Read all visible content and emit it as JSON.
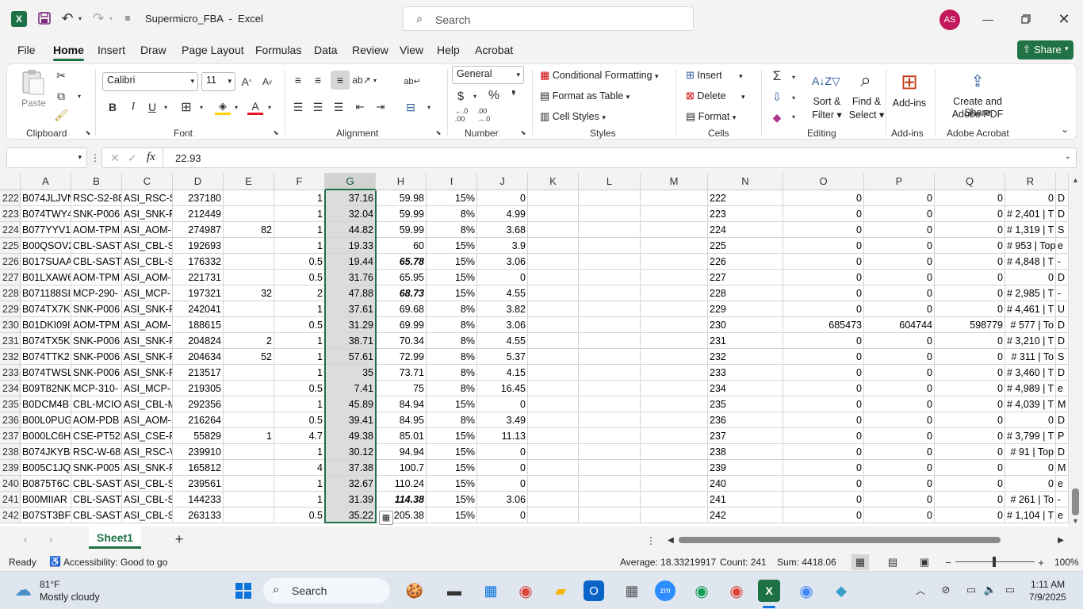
{
  "window": {
    "title": "Supermicro_FBA  -  Excel",
    "search_placeholder": "Search",
    "avatar": "AS"
  },
  "menu": {
    "tabs": [
      "File",
      "Home",
      "Insert",
      "Draw",
      "Page Layout",
      "Formulas",
      "Data",
      "Review",
      "View",
      "Help",
      "Acrobat"
    ],
    "share": "Share"
  },
  "ribbon": {
    "clipboard": {
      "paste": "Paste",
      "group": "Clipboard"
    },
    "font": {
      "name": "Calibri",
      "size": "11",
      "group": "Font"
    },
    "alignment": {
      "group": "Alignment"
    },
    "number": {
      "format": "General",
      "group": "Number"
    },
    "styles": {
      "conditional": "Conditional Formatting",
      "table": "Format as Table",
      "cell_styles": "Cell Styles",
      "group": "Styles"
    },
    "cells": {
      "insert": "Insert",
      "delete": "Delete",
      "format": "Format",
      "group": "Cells"
    },
    "editing": {
      "sort": "Sort &",
      "filter": "Filter",
      "find": "Find &",
      "select": "Select",
      "group": "Editing"
    },
    "addins": {
      "label": "Add-ins",
      "group": "Add-ins"
    },
    "acrobat": {
      "line1": "Create and Share",
      "line2": "Adobe PDF",
      "group": "Adobe Acrobat"
    }
  },
  "formula": {
    "name_box": "",
    "fx": "fx",
    "value": "22.93"
  },
  "grid": {
    "columns": [
      "A",
      "B",
      "C",
      "D",
      "E",
      "F",
      "G",
      "H",
      "I",
      "J",
      "K",
      "L",
      "M",
      "N",
      "O",
      "P",
      "Q",
      "R"
    ],
    "rows": [
      {
        "n": "222",
        "a": "B074JLJVN",
        "b": "RSC-S2-88",
        "c": "ASI_RSC-S",
        "d": "237180",
        "e": "",
        "f": "1",
        "g": "37.16",
        "h": "59.98",
        "i": "15%",
        "j": "0",
        "o": "0",
        "p": "0",
        "q": "0",
        "r": "0",
        "s": "D"
      },
      {
        "n": "223",
        "a": "B074TWY4",
        "b": "SNK-P006",
        "c": "ASI_SNK-F",
        "d": "212449",
        "e": "",
        "f": "1",
        "g": "32.04",
        "h": "59.99",
        "i": "8%",
        "j": "4.99",
        "o": "0",
        "p": "0",
        "q": "0",
        "r": "# 2,401  |  T",
        "s": "D"
      },
      {
        "n": "224",
        "a": "B077YYV1",
        "b": "AOM-TPM",
        "c": "ASI_AOM-",
        "d": "274987",
        "e": "82",
        "f": "1",
        "g": "44.82",
        "h": "59.99",
        "i": "8%",
        "j": "3.68",
        "o": "0",
        "p": "0",
        "q": "0",
        "r": "# 1,319  |  T",
        "s": "S"
      },
      {
        "n": "225",
        "a": "B00QSOV2",
        "b": "CBL-SAST-",
        "c": "ASI_CBL-S",
        "d": "192693",
        "e": "",
        "f": "1",
        "g": "19.33",
        "h": "60",
        "i": "15%",
        "j": "3.9",
        "o": "0",
        "p": "0",
        "q": "0",
        "r": "# 953  |  Top",
        "s": "e"
      },
      {
        "n": "226",
        "a": "B017SUAA",
        "b": "CBL-SAST-",
        "c": "ASI_CBL-S",
        "d": "176332",
        "e": "",
        "f": "0.5",
        "g": "19.44",
        "h": "65.78",
        "hb": true,
        "i": "15%",
        "j": "3.06",
        "o": "0",
        "p": "0",
        "q": "0",
        "r": "# 4,848  |  T",
        "s": "-"
      },
      {
        "n": "227",
        "a": "B01LXAW6",
        "b": "AOM-TPM",
        "c": "ASI_AOM-",
        "d": "221731",
        "e": "",
        "f": "0.5",
        "g": "31.76",
        "h": "65.95",
        "i": "15%",
        "j": "0",
        "o": "0",
        "p": "0",
        "q": "0",
        "r": "0",
        "s": "D"
      },
      {
        "n": "228",
        "a": "B071188SI",
        "b": "MCP-290-",
        "c": "ASI_MCP-",
        "d": "197321",
        "e": "32",
        "f": "2",
        "g": "47.88",
        "h": "68.73",
        "hb": true,
        "i": "15%",
        "j": "4.55",
        "o": "0",
        "p": "0",
        "q": "0",
        "r": "# 2,985  |  T",
        "s": "-"
      },
      {
        "n": "229",
        "a": "B074TX7K",
        "b": "SNK-P006",
        "c": "ASI_SNK-F",
        "d": "242041",
        "e": "",
        "f": "1",
        "g": "37.61",
        "h": "69.68",
        "i": "8%",
        "j": "3.82",
        "o": "0",
        "p": "0",
        "q": "0",
        "r": "# 4,461  |  T",
        "s": "U"
      },
      {
        "n": "230",
        "a": "B01DKI09I",
        "b": "AOM-TPM",
        "c": "ASI_AOM-",
        "d": "188615",
        "e": "",
        "f": "0.5",
        "g": "31.29",
        "h": "69.99",
        "i": "8%",
        "j": "3.06",
        "o": "685473",
        "p": "604744",
        "q": "598779",
        "r": "# 577  |  To",
        "s": "D"
      },
      {
        "n": "231",
        "a": "B074TX5K",
        "b": "SNK-P006",
        "c": "ASI_SNK-F",
        "d": "204824",
        "e": "2",
        "f": "1",
        "g": "38.71",
        "h": "70.34",
        "i": "8%",
        "j": "4.55",
        "o": "0",
        "p": "0",
        "q": "0",
        "r": "# 3,210  |  T",
        "s": "D"
      },
      {
        "n": "232",
        "a": "B074TTK2I",
        "b": "SNK-P006",
        "c": "ASI_SNK-F",
        "d": "204634",
        "e": "52",
        "f": "1",
        "g": "57.61",
        "h": "72.99",
        "i": "8%",
        "j": "5.37",
        "o": "0",
        "p": "0",
        "q": "0",
        "r": "# 311  |  To",
        "s": "S"
      },
      {
        "n": "233",
        "a": "B074TWSL",
        "b": "SNK-P006",
        "c": "ASI_SNK-F",
        "d": "213517",
        "e": "",
        "f": "1",
        "g": "35",
        "h": "73.71",
        "i": "8%",
        "j": "4.15",
        "o": "0",
        "p": "0",
        "q": "0",
        "r": "# 3,460  |  T",
        "s": "D"
      },
      {
        "n": "234",
        "a": "B09T82NK",
        "b": "MCP-310-",
        "c": "ASI_MCP-",
        "d": "219305",
        "e": "",
        "f": "0.5",
        "g": "7.41",
        "h": "75",
        "i": "8%",
        "j": "16.45",
        "o": "0",
        "p": "0",
        "q": "0",
        "r": "# 4,989  |  T",
        "s": "e"
      },
      {
        "n": "235",
        "a": "B0DCM4B",
        "b": "CBL-MCIO",
        "c": "ASI_CBL-M",
        "d": "292356",
        "e": "",
        "f": "1",
        "g": "45.89",
        "h": "84.94",
        "i": "15%",
        "j": "0",
        "o": "0",
        "p": "0",
        "q": "0",
        "r": "# 4,039  |  T",
        "s": "M"
      },
      {
        "n": "236",
        "a": "B00L0PUG",
        "b": "AOM-PDB",
        "c": "ASI_AOM-",
        "d": "216264",
        "e": "",
        "f": "0.5",
        "g": "39.41",
        "h": "84.95",
        "i": "8%",
        "j": "3.49",
        "o": "0",
        "p": "0",
        "q": "0",
        "r": "0",
        "s": "D"
      },
      {
        "n": "237",
        "a": "B000LC6H",
        "b": "CSE-PT52L",
        "c": "ASI_CSE-P",
        "d": "55829",
        "e": "1",
        "f": "4.7",
        "g": "49.38",
        "h": "85.01",
        "i": "15%",
        "j": "11.13",
        "o": "0",
        "p": "0",
        "q": "0",
        "r": "# 3,799  |  T",
        "s": "P"
      },
      {
        "n": "238",
        "a": "B074JKYBJ",
        "b": "RSC-W-68",
        "c": "ASI_RSC-V",
        "d": "239910",
        "e": "",
        "f": "1",
        "g": "30.12",
        "h": "94.94",
        "i": "15%",
        "j": "0",
        "o": "0",
        "p": "0",
        "q": "0",
        "r": "# 91  |  Top",
        "s": "D"
      },
      {
        "n": "239",
        "a": "B005C1JQ",
        "b": "SNK-P005",
        "c": "ASI_SNK-F",
        "d": "165812",
        "e": "",
        "f": "4",
        "g": "37.38",
        "h": "100.7",
        "i": "15%",
        "j": "0",
        "o": "0",
        "p": "0",
        "q": "0",
        "r": "0",
        "s": "M"
      },
      {
        "n": "240",
        "a": "B0875T6C",
        "b": "CBL-SAST-",
        "c": "ASI_CBL-S",
        "d": "239561",
        "e": "",
        "f": "1",
        "g": "32.67",
        "h": "110.24",
        "i": "15%",
        "j": "0",
        "o": "0",
        "p": "0",
        "q": "0",
        "r": "0",
        "s": "e"
      },
      {
        "n": "241",
        "a": "B00MIIAR",
        "b": "CBL-SAST-",
        "c": "ASI_CBL-S",
        "d": "144233",
        "e": "",
        "f": "1",
        "g": "31.39",
        "h": "114.38",
        "hb": true,
        "i": "15%",
        "j": "3.06",
        "o": "0",
        "p": "0",
        "q": "0",
        "r": "# 261  |  To",
        "s": "-"
      },
      {
        "n": "242",
        "a": "B07ST3BF",
        "b": "CBL-SAST-",
        "c": "ASI_CBL-S",
        "d": "263133",
        "e": "",
        "f": "0.5",
        "g": "35.22",
        "h": "205.38",
        "i": "15%",
        "j": "0",
        "o": "0",
        "p": "0",
        "q": "0",
        "r": "# 1,104  |  T",
        "s": "e"
      }
    ]
  },
  "sheets": {
    "active": "Sheet1"
  },
  "status": {
    "ready": "Ready",
    "accessibility": "Accessibility: Good to go",
    "average": "Average: 18.33219917",
    "count": "Count: 241",
    "sum": "Sum: 4418.06",
    "zoom": "100%"
  },
  "taskbar": {
    "temp": "81°F",
    "weather": "Mostly cloudy",
    "search": "Search",
    "time": "1:11 AM",
    "date": "7/9/2025"
  },
  "colors": {
    "excel_green": "#1e7145",
    "share_green": "#217346",
    "avatar": "#c2185b"
  }
}
